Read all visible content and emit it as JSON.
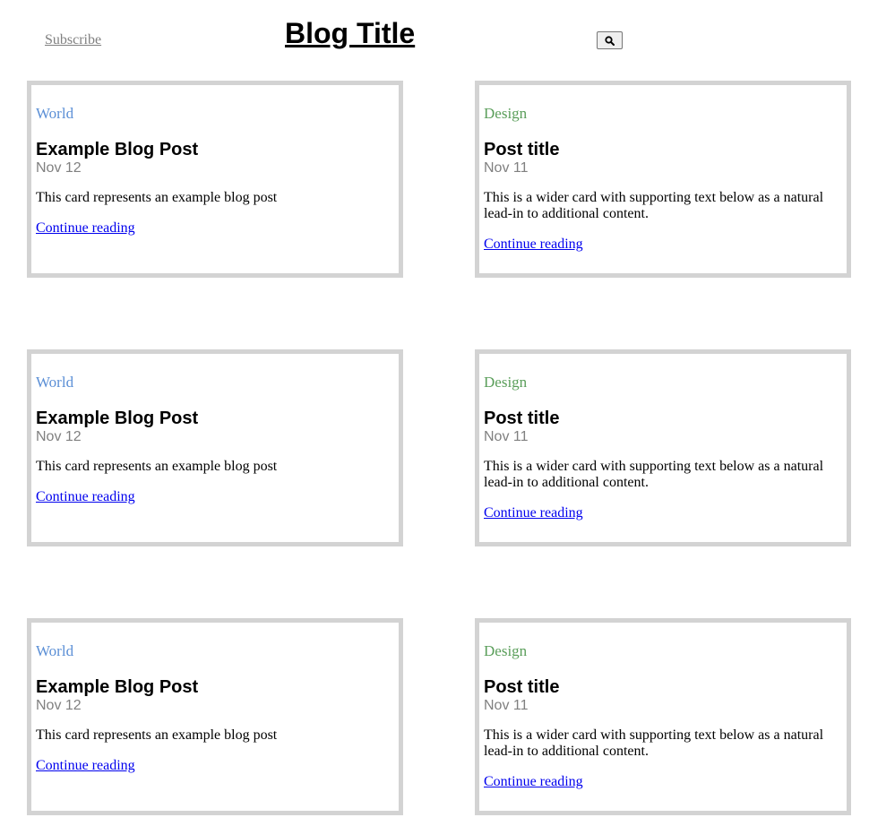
{
  "header": {
    "subscribe_label": "Subscribe",
    "title": "Blog Title",
    "search_icon": "search-icon"
  },
  "colors": {
    "card_border": "#d3d3d3",
    "world_category": "#5b8fd6",
    "design_category": "#5a9e5a",
    "link": "#0000ee",
    "muted": "#808080"
  },
  "cards": [
    {
      "category": "World",
      "title": "Example Blog Post",
      "date": "Nov 12",
      "text": "This card represents an example blog post",
      "link_label": "Continue reading"
    },
    {
      "category": "Design",
      "title": "Post title",
      "date": "Nov 11",
      "text": "This is a wider card with supporting text below as a natural lead-in to additional content.",
      "link_label": "Continue reading"
    },
    {
      "category": "World",
      "title": "Example Blog Post",
      "date": "Nov 12",
      "text": "This card represents an example blog post",
      "link_label": "Continue reading"
    },
    {
      "category": "Design",
      "title": "Post title",
      "date": "Nov 11",
      "text": "This is a wider card with supporting text below as a natural lead-in to additional content.",
      "link_label": "Continue reading"
    },
    {
      "category": "World",
      "title": "Example Blog Post",
      "date": "Nov 12",
      "text": "This card represents an example blog post",
      "link_label": "Continue reading"
    },
    {
      "category": "Design",
      "title": "Post title",
      "date": "Nov 11",
      "text": "This is a wider card with supporting text below as a natural lead-in to additional content.",
      "link_label": "Continue reading"
    }
  ]
}
